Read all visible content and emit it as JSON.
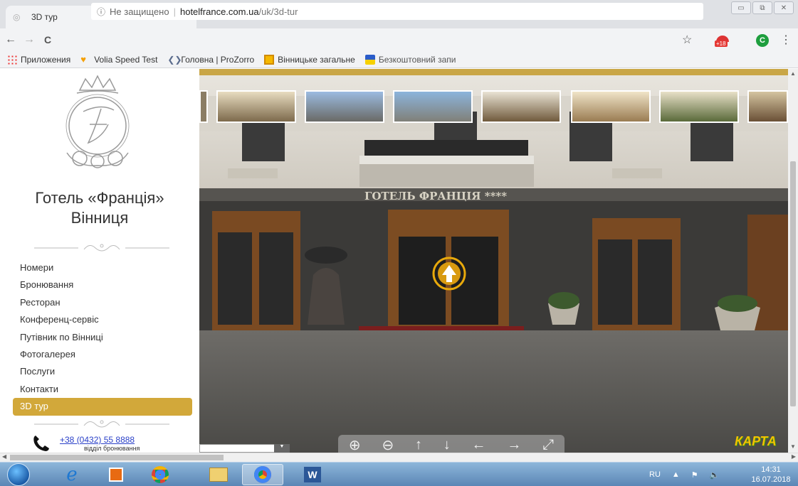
{
  "browser": {
    "tab_title": "3D тур",
    "tab_close": "×",
    "new_tab": "+",
    "window_controls": [
      "▭",
      "⧉",
      "✕"
    ],
    "nav_back": "←",
    "nav_forward": "→",
    "nav_reload": "C",
    "address": {
      "info": "ⓘ",
      "security": "Не защищено",
      "separator": "|",
      "host": "hotelfrance.com.ua",
      "path": "/uk/3d-tur"
    },
    "star": "☆",
    "extension_badge": "+18",
    "profile_initial": "C",
    "menu": "⋮",
    "bookmarks": [
      {
        "label": "Приложения",
        "icon": "apps-icon"
      },
      {
        "label": "Volia Speed Test",
        "icon": "volia-icon"
      },
      {
        "label": "Головна | ProZorro",
        "icon": "prozorro-icon"
      },
      {
        "label": "Вінницьке загальне",
        "icon": "vin-icon"
      },
      {
        "label": "Безкоштовний запи",
        "icon": "ua-icon"
      }
    ]
  },
  "site": {
    "title_line1": "Готель «Франція»",
    "title_line2": "Вінниця",
    "nav": [
      {
        "label": "Номери",
        "active": false
      },
      {
        "label": "Бронювання",
        "active": false
      },
      {
        "label": "Ресторан",
        "active": false
      },
      {
        "label": "Конференц-сервіс",
        "active": false
      },
      {
        "label": "Путівник по Вінниці",
        "active": false
      },
      {
        "label": "Фотогалерея",
        "active": false
      },
      {
        "label": "Послуги",
        "active": false
      },
      {
        "label": "Контакти",
        "active": false
      },
      {
        "label": "3D тур",
        "active": true
      }
    ],
    "phone": "+38 (0432) 55 8888",
    "phone_caption": "відділ бронювання",
    "accent_color": "#d2a83a"
  },
  "viewer": {
    "building_sign": "ГОТЕЛЬ ФРАНЦІЯ ****",
    "controls": [
      "⊕",
      "⊖",
      "↑",
      "↓",
      "←",
      "→",
      "⤢"
    ],
    "map_label": "КАРТА",
    "thumbnails": 8
  },
  "taskbar": {
    "language": "RU",
    "time": "14:31",
    "date": "16.07.2018"
  }
}
